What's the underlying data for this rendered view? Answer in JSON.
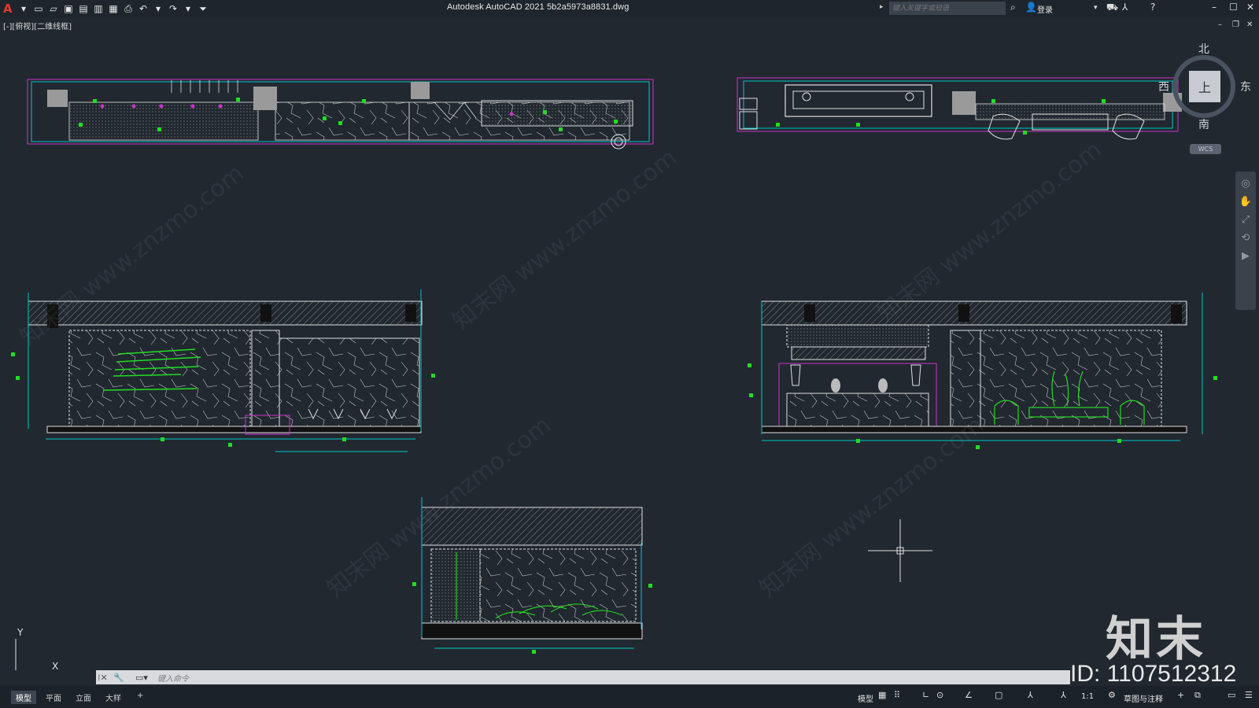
{
  "app": {
    "title": "Autodesk AutoCAD 2021    5b2a5973a8831.dwg",
    "logo": "A",
    "search_placeholder": "键入关键字或短语",
    "login_label": "登录",
    "view_label": "[-][俯视][二维线框]"
  },
  "quick_access": [
    "new-icon",
    "open-icon",
    "save-icon",
    "saveas-icon",
    "publish-icon",
    "plot-icon",
    "print-icon",
    "undo-icon",
    "redo-icon",
    "customize-icon"
  ],
  "viewcube": {
    "face": "上",
    "north": "北",
    "south": "南",
    "east": "东",
    "west": "西",
    "wcs": "WCS"
  },
  "ucs": {
    "x": "X",
    "y": "Y"
  },
  "command": {
    "placeholder": "键入命令"
  },
  "tabs": [
    {
      "label": "模型",
      "active": true
    },
    {
      "label": "平面",
      "active": false
    },
    {
      "label": "立面",
      "active": false
    },
    {
      "label": "大样",
      "active": false
    },
    {
      "label": "+",
      "active": false
    }
  ],
  "status": {
    "model": "模型",
    "scale": "1:1",
    "workspace": "草图与注释"
  },
  "watermark": {
    "logo": "知末",
    "id": "ID: 1107512312",
    "text": "知末网 www.znzmo.com"
  },
  "colors": {
    "background": "#212830",
    "cyan": "#00c8c8",
    "magenta": "#cc33cc",
    "green": "#22dd22",
    "white": "#e0e0e0"
  }
}
